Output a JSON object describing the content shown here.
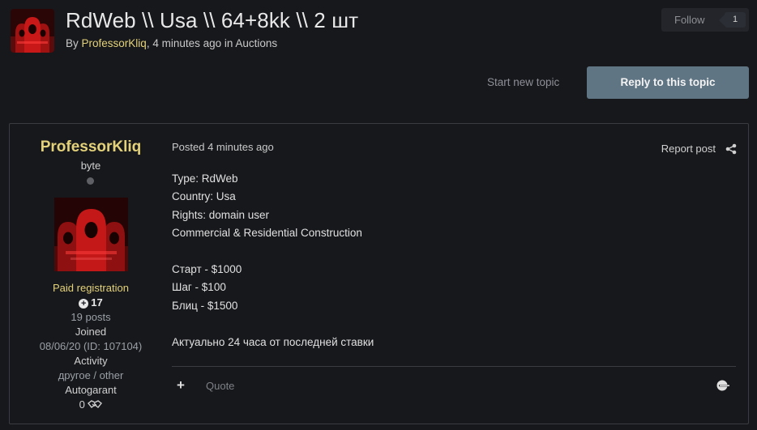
{
  "topic": {
    "title": "RdWeb \\\\ Usa \\\\ 64+8kk \\\\ 2 шт",
    "by": "By ",
    "author": "ProfessorKliq",
    "time_prefix": ", 4 minutes ago in ",
    "forum": "Auctions"
  },
  "actions": {
    "follow_label": "Follow",
    "follow_count": "1",
    "start_new_topic": "Start new topic",
    "reply": "Reply to this topic"
  },
  "post": {
    "author": {
      "name": "ProfessorKliq",
      "rank": "byte",
      "group": "Paid registration",
      "reputation": "17",
      "posts": "19 posts",
      "joined_label": "Joined",
      "joined_value": "08/06/20 (ID: 107104)",
      "activity_label": "Activity",
      "activity_value": "другое / other",
      "autogarant_label": "Autogarant",
      "autogarant_value": "0"
    },
    "posted": "Posted 4 minutes ago",
    "report": "Report post",
    "body": [
      "Type: RdWeb",
      "Country: Usa",
      "Rights: domain user",
      "Commercial & Residential Construction",
      "",
      "Старт - $1000",
      "Шаг - $100",
      "Блиц - $1500",
      "",
      "Актуально 24 часа от последней ставки"
    ],
    "quote": "Quote"
  },
  "colors": {
    "background": "#17181c",
    "author_accent": "#e4d27a",
    "reply_button": "#607584"
  },
  "icons": {
    "share": "share-icon",
    "plus": "plus-icon",
    "reaction": "reaction-icon",
    "handshake": "handshake-icon"
  }
}
